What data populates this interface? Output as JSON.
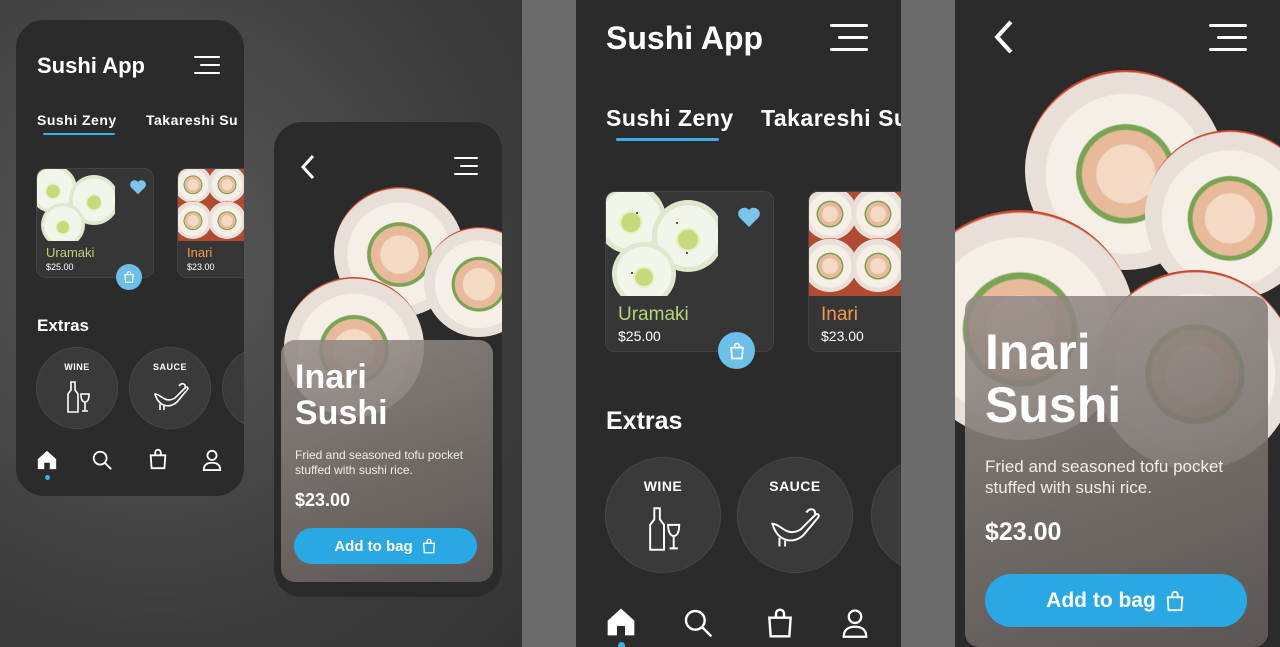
{
  "app": {
    "title": "Sushi App"
  },
  "tabs": [
    "Sushi Zeny",
    "Takareshi Su"
  ],
  "products": [
    {
      "name": "Uramaki",
      "price": "$25.00",
      "name_color": "#b7d37a"
    },
    {
      "name": "Inari",
      "price": "$23.00",
      "name_color": "#f09a4f"
    }
  ],
  "extras_heading": "Extras",
  "extras": [
    {
      "label": "WINE",
      "icon": "wine-bottle-glass-icon"
    },
    {
      "label": "SAUCE",
      "icon": "sauce-boat-icon"
    }
  ],
  "nav": [
    "home-icon",
    "search-icon",
    "bag-icon",
    "user-icon"
  ],
  "detail": {
    "title_line1": "Inari",
    "title_line2": "Sushi",
    "description": "Fried and seasoned tofu pocket stuffed with sushi rice.",
    "price": "$23.00",
    "button": "Add to bag"
  },
  "colors": {
    "accent": "#3daee9",
    "button": "#2aa8e4",
    "screen_bg": "#2b2b2b",
    "heart": "#7cc4ec"
  }
}
